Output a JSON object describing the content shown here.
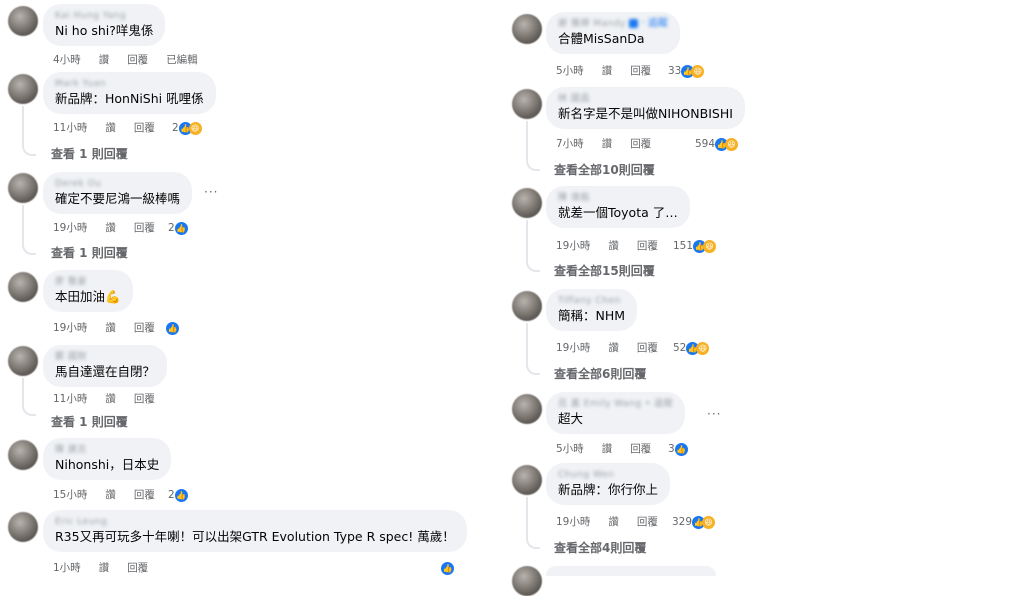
{
  "left": [
    {
      "name": "Kai Hung Yang",
      "text": "Ni ho shi?咩鬼係",
      "time": "4小時",
      "like": "讚",
      "reply": "回覆",
      "edited": "已編輯"
    },
    {
      "name": "Mark Yuan",
      "text": "新品牌：HonNiShi 吼哩係",
      "time": "11小時",
      "like": "讚",
      "reply": "回覆",
      "count": "2",
      "view": "查看 1 則回覆"
    },
    {
      "name": "Derek Ou",
      "text": "確定不要尼鴻一級棒嗎",
      "time": "19小時",
      "like": "讚",
      "reply": "回覆",
      "count": "2",
      "view": "查看 1 則回覆",
      "more": "···"
    },
    {
      "name": "廖 敬豪",
      "text": "本田加油💪",
      "time": "19小時",
      "like": "讚",
      "reply": "回覆"
    },
    {
      "name": "鄭 國財",
      "text": "馬自達還在自閉？",
      "time": "11小時",
      "like": "讚",
      "reply": "回覆",
      "view": "查看 1 則回覆"
    },
    {
      "name": "陳 建志",
      "text": "Nihonshi，日本史",
      "time": "15小時",
      "like": "讚",
      "reply": "回覆",
      "count": "2"
    },
    {
      "name": "Eric Leung",
      "text": "R35又再可玩多十年喇！可以出架GTR Evolution Type R spec! 萬歲！",
      "time": "1小時",
      "like": "讚",
      "reply": "回覆"
    }
  ],
  "right": [
    {
      "name": "謝 雅婷 Mandy",
      "follow": "· 追蹤",
      "text": "合體MisSanDa",
      "time": "5小時",
      "like": "讚",
      "reply": "回覆",
      "count": "33"
    },
    {
      "name": "林 國昌",
      "text": "新名字是不是叫做NIHONBISHI",
      "time": "7小時",
      "like": "讚",
      "reply": "回覆",
      "count": "594",
      "view": "查看全部10則回覆"
    },
    {
      "name": "陳 偉銘",
      "text": "就差一個Toyota 了…",
      "time": "19小時",
      "like": "讚",
      "reply": "回覆",
      "count": "151",
      "view": "查看全部15則回覆"
    },
    {
      "name": "Tiffany Chen",
      "text": "簡稱：NHM",
      "time": "19小時",
      "like": "讚",
      "reply": "回覆",
      "count": "52",
      "view": "查看全部6則回覆"
    },
    {
      "name": "呂 嘉 Emily Wang • 追蹤",
      "text": "超大",
      "time": "5小時",
      "like": "讚",
      "reply": "回覆",
      "count": "3",
      "more": "···"
    },
    {
      "name": "Chung Wen",
      "text": "新品牌：你行你上",
      "time": "19小時",
      "like": "讚",
      "reply": "回覆",
      "count": "329",
      "view": "查看全部4則回覆"
    }
  ],
  "icons": {
    "like": "👍",
    "haha": "😆"
  },
  "colors": {
    "bubble": "#f0f2f5",
    "like": "#1877f2",
    "haha": "#f7b125",
    "meta": "#65676b"
  }
}
